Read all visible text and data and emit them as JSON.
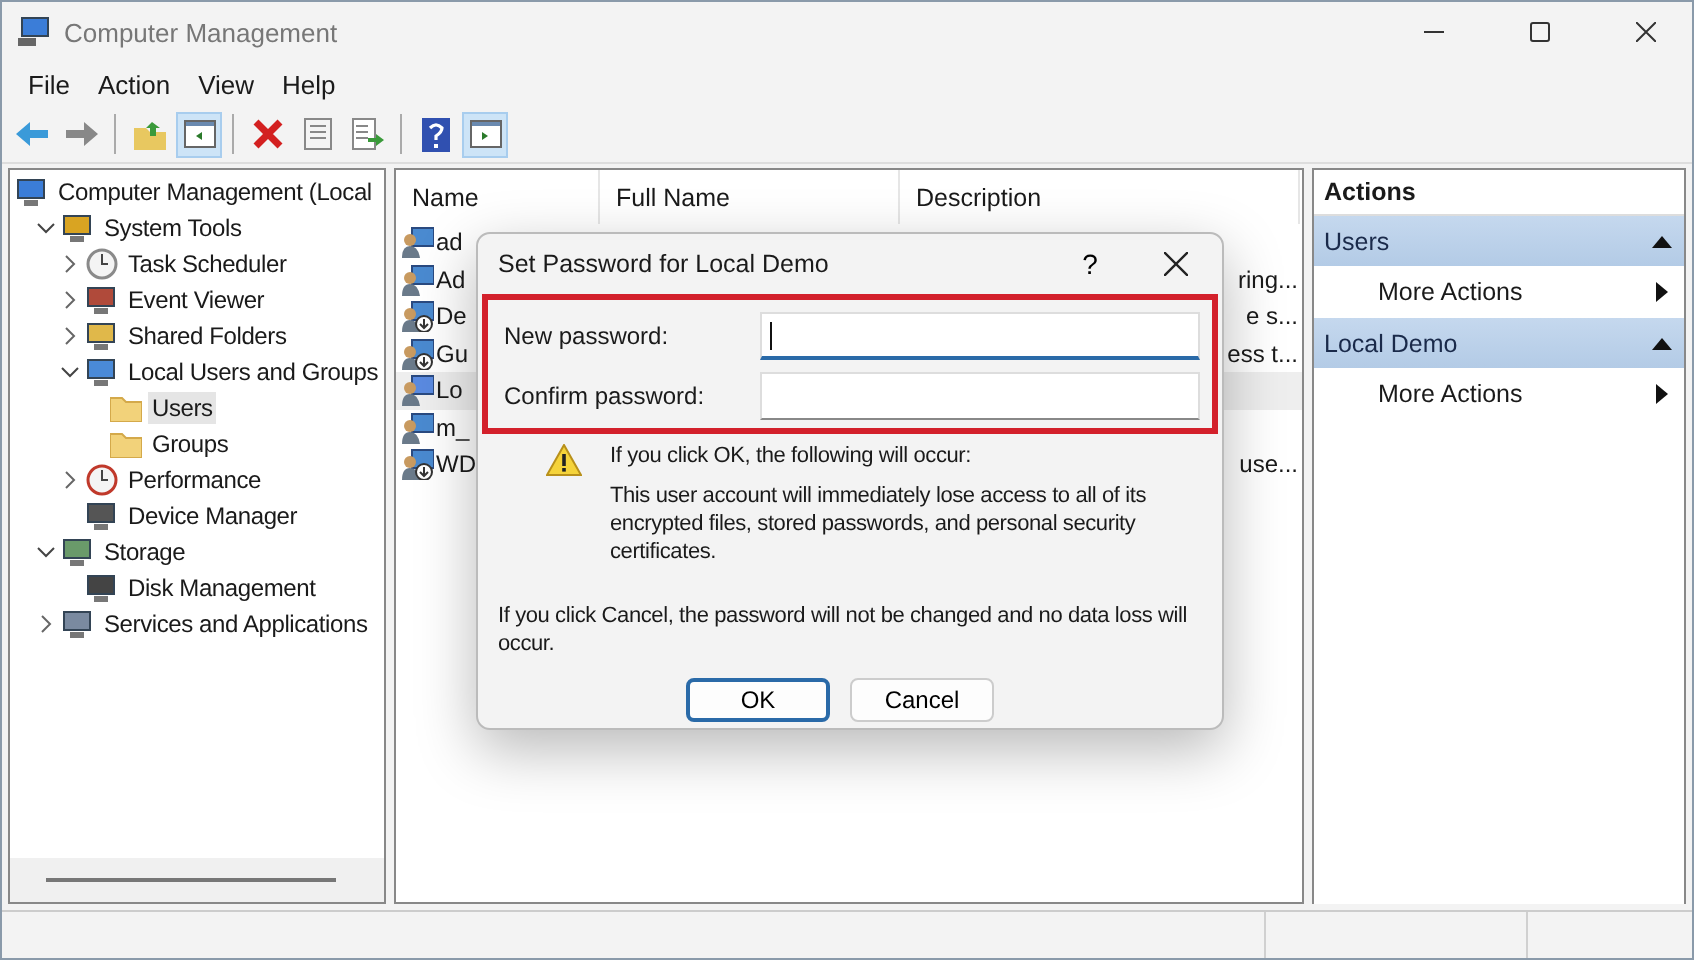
{
  "window": {
    "title": "Computer Management"
  },
  "menu": [
    "File",
    "Action",
    "View",
    "Help"
  ],
  "toolbar": [
    {
      "kind": "back",
      "pressed": false
    },
    {
      "kind": "forward",
      "pressed": false
    },
    {
      "kind": "up",
      "pressed": false
    },
    {
      "kind": "tree",
      "pressed": true
    },
    {
      "kind": "delete",
      "pressed": false
    },
    {
      "kind": "properties",
      "pressed": false
    },
    {
      "kind": "export",
      "pressed": false
    },
    {
      "kind": "help",
      "pressed": false
    },
    {
      "kind": "actionpane",
      "pressed": true
    }
  ],
  "tree": [
    {
      "label": "Computer Management (Local",
      "kind": "computer",
      "selected": false,
      "children": [
        {
          "label": "System Tools",
          "kind": "tools",
          "expanded": true,
          "selected": false,
          "children": [
            {
              "label": "Task Scheduler",
              "kind": "clock",
              "expanded": false,
              "selected": false
            },
            {
              "label": "Event Viewer",
              "kind": "log",
              "expanded": false,
              "selected": false
            },
            {
              "label": "Shared Folders",
              "kind": "share",
              "expanded": false,
              "selected": false
            },
            {
              "label": "Local Users and Groups",
              "kind": "users",
              "expanded": true,
              "selected": false,
              "children": [
                {
                  "label": "Users",
                  "kind": "folder",
                  "selected": true
                },
                {
                  "label": "Groups",
                  "kind": "folder",
                  "selected": false
                }
              ]
            },
            {
              "label": "Performance",
              "kind": "perf",
              "expanded": false,
              "selected": false
            },
            {
              "label": "Device Manager",
              "kind": "device",
              "selected": false
            }
          ]
        },
        {
          "label": "Storage",
          "kind": "storage",
          "expanded": true,
          "selected": false,
          "children": [
            {
              "label": "Disk Management",
              "kind": "disk",
              "selected": false
            }
          ]
        },
        {
          "label": "Services and Applications",
          "kind": "services",
          "expanded": false,
          "selected": false
        }
      ]
    }
  ],
  "table": {
    "columns": [
      "Name",
      "Full Name",
      "Description"
    ],
    "rows": [
      {
        "name": "ad",
        "description": "",
        "kind": "user"
      },
      {
        "name": "Ad",
        "description": "ring...",
        "kind": "user"
      },
      {
        "name": "De",
        "description": "e s...",
        "kind": "disabled-user"
      },
      {
        "name": "Gu",
        "description": "ess t...",
        "kind": "disabled-user"
      },
      {
        "name": "Lo",
        "description": "",
        "kind": "selected-user"
      },
      {
        "name": "m_",
        "description": "",
        "kind": "user"
      },
      {
        "name": "WD",
        "description": "use...",
        "kind": "disabled-user"
      }
    ]
  },
  "actions": {
    "title": "Actions",
    "sections": [
      {
        "title": "Users",
        "expanded": true,
        "items": [
          "More Actions"
        ]
      },
      {
        "title": "Local Demo",
        "expanded": true,
        "items": [
          "More Actions"
        ]
      }
    ]
  },
  "dialog": {
    "title": "Set Password for Local Demo",
    "help_glyph": "?",
    "fields": [
      {
        "label": "New password:",
        "focused": true
      },
      {
        "label": "Confirm password:",
        "focused": false
      }
    ],
    "warning_heading": "If you click OK, the following will occur:",
    "warning_text": "This user account will immediately lose access to all of its encrypted files, stored passwords, and personal security certificates.",
    "cancel_note": "If you click Cancel, the password will not be changed and no data loss will occur.",
    "buttons": [
      {
        "label": "OK",
        "default": true
      },
      {
        "label": "Cancel",
        "default": false
      }
    ]
  }
}
